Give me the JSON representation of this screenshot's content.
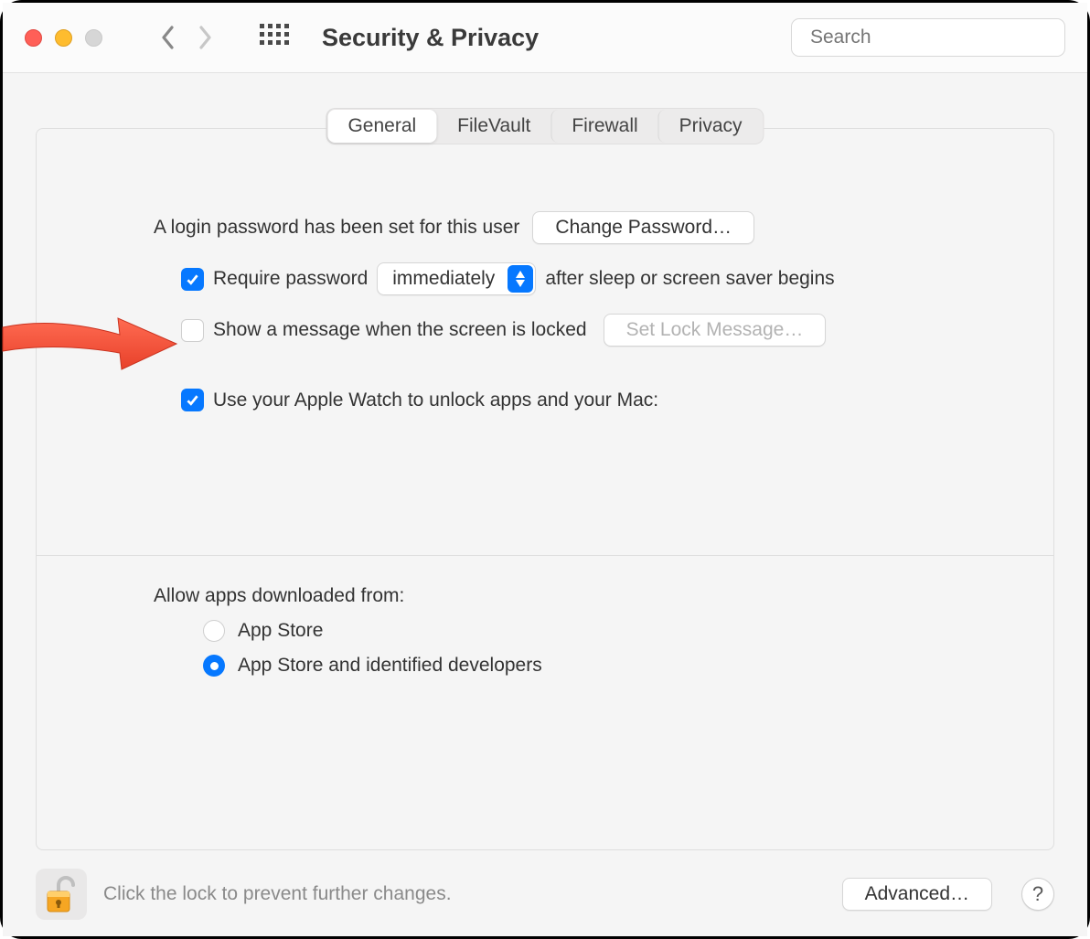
{
  "toolbar": {
    "title": "Security & Privacy",
    "search_placeholder": "Search"
  },
  "tabs": [
    "General",
    "FileVault",
    "Firewall",
    "Privacy"
  ],
  "login": {
    "password_set_text": "A login password has been set for this user",
    "change_password_button": "Change Password…",
    "require_password_label_pre": "Require password",
    "require_password_delay": "immediately",
    "require_password_label_post": "after sleep or screen saver begins",
    "show_message_label": "Show a message when the screen is locked",
    "set_lock_message_button": "Set Lock Message…",
    "apple_watch_label": "Use your Apple Watch to unlock apps and your Mac:"
  },
  "downloads": {
    "section_label": "Allow apps downloaded from:",
    "option_appstore": "App Store",
    "option_identified": "App Store and identified developers"
  },
  "footer": {
    "lock_hint": "Click the lock to prevent further changes.",
    "advanced_button": "Advanced…",
    "help_label": "?"
  }
}
